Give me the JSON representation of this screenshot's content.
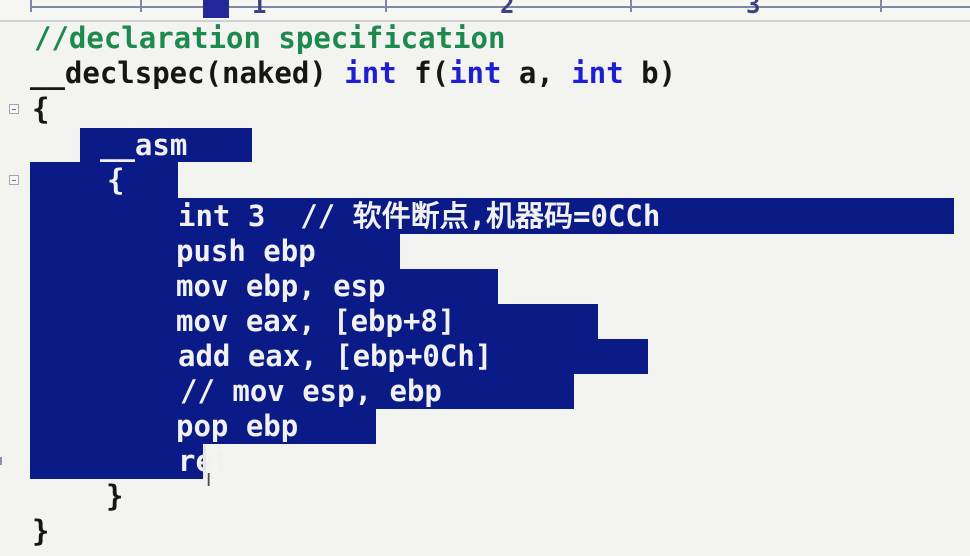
{
  "ruler": {
    "marks": [
      "1",
      "2",
      "3"
    ]
  },
  "code": {
    "comment_line": "//declaration specification",
    "decl": {
      "prefix": "__declspec(naked) ",
      "kw_int_1": "int",
      "mid_1": " f(",
      "kw_int_2": "int",
      "mid_2": " a, ",
      "kw_int_3": "int",
      "suffix": " b)"
    },
    "open_brace": "{",
    "asm_keyword": "__asm",
    "asm_open_brace": "{",
    "asm_lines": [
      "int 3  // 软件断点,机器码=0CCh",
      "push ebp",
      "mov ebp, esp",
      "mov eax, [ebp+8]",
      "add eax, [ebp+0Ch]",
      "// mov esp, ebp",
      "pop ebp",
      "ret"
    ],
    "asm_close_brace": "}",
    "close_brace": "}"
  },
  "colors": {
    "selection": "#0a1a86",
    "keyword": "#1d1fd0",
    "comment": "#1c8a4e",
    "text": "#161616",
    "selected_text": "#f1f1f1"
  },
  "icons": {
    "fold_marker": "collapse-box-icon",
    "cursor": "ibeam-cursor-icon"
  }
}
